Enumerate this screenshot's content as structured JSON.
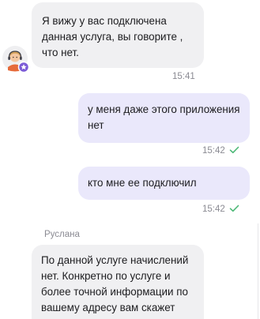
{
  "messages": [
    {
      "direction": "incoming",
      "text": "Я вижу у вас подключена данная услуга, вы говорите , что нет.",
      "time": "15:41"
    },
    {
      "direction": "outgoing",
      "text": "у меня даже этого приложения нет",
      "time": "15:42",
      "status_icon": "check-icon"
    },
    {
      "direction": "outgoing",
      "text": "кто мне ее подключил",
      "time": "15:42",
      "status_icon": "check-icon"
    },
    {
      "direction": "incoming",
      "sender": "Руслана",
      "text": "По данной услуге начислений нет. Конкретно по услуге и более точной информации по вашему адресу вам скажет"
    }
  ],
  "agent_avatar": {
    "icon": "support-agent-avatar",
    "badge_icon": "star-badge-icon"
  },
  "colors": {
    "incoming_bubble": "#f0f0f2",
    "outgoing_bubble": "#eae8fb",
    "check_mark": "#4cb876",
    "badge": "#7b5ad6",
    "meta_text": "#8b8b93"
  }
}
